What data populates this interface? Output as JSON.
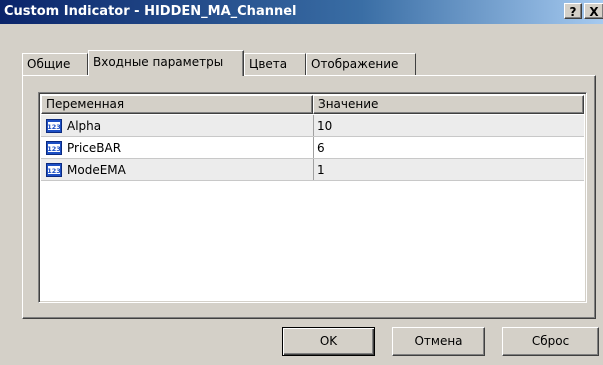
{
  "window": {
    "title": "Custom Indicator - HIDDEN_MA_Channel",
    "help_label": "?",
    "close_label": "X"
  },
  "tabs": [
    {
      "label": "Общие",
      "active": false
    },
    {
      "label": "Входные параметры",
      "active": true
    },
    {
      "label": "Цвета",
      "active": false
    },
    {
      "label": "Отображение",
      "active": false
    }
  ],
  "table": {
    "columns": [
      "Переменная",
      "Значение"
    ],
    "rows": [
      {
        "icon": "numeric-123-icon",
        "name": "Alpha",
        "value": "10"
      },
      {
        "icon": "numeric-123-icon",
        "name": "PriceBAR",
        "value": "6"
      },
      {
        "icon": "numeric-123-icon",
        "name": "ModeEMA",
        "value": "1"
      }
    ]
  },
  "buttons": {
    "ok": "OK",
    "cancel": "Отмена",
    "reset": "Сброс"
  },
  "colors": {
    "title_gradient_start": "#0a246a",
    "title_gradient_end": "#a6caf0",
    "face": "#d4d0c8",
    "row_alt": "#ececec",
    "icon_blue": "#1c4fc4"
  }
}
